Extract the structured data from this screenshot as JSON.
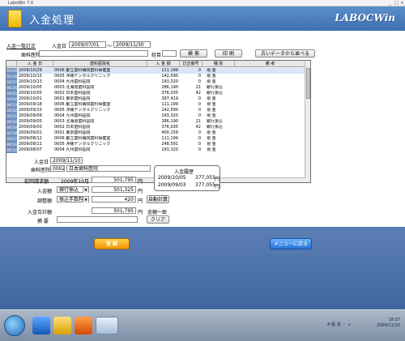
{
  "window": {
    "title": "LaboWin 7.0"
  },
  "header": {
    "title": "入金処理",
    "logo": "LABOCWin"
  },
  "tab": {
    "label": "入金一覧訂正"
  },
  "period": {
    "label": "入金日",
    "from": "2009/07/01",
    "sep": "～",
    "to": "2009/11/30"
  },
  "search": {
    "client_label": "歯科医院",
    "client_value": "",
    "lastname_label": "姓目",
    "lastname_value": "",
    "search_btn": "検 索",
    "print_btn": "印 刷",
    "reorder_btn": "古いデータから並べる"
  },
  "grid": {
    "headers": [
      "入 金 日",
      "歯科医院名",
      "入 金 額",
      "訂正番号",
      "種 別",
      "備 考"
    ],
    "rows": [
      {
        "idx": "00529",
        "date": "2009/10/29",
        "clinic": "0006 都立歯科病院歯科保健室",
        "amount": "111,199",
        "seq": "0",
        "type": "現 金"
      },
      {
        "idx": "00528",
        "date": "2009/10/15",
        "clinic": "0005 沖縄デンタルクリニック",
        "amount": "142,590",
        "seq": "0",
        "type": "現 金"
      },
      {
        "idx": "00527",
        "date": "2009/10/13",
        "clinic": "0004 九州歯科医院",
        "amount": "193,320",
        "seq": "0",
        "type": "現 金"
      },
      {
        "idx": "00526",
        "date": "2009/10/05",
        "clinic": "0003 北海道歯科医院",
        "amount": "286,190",
        "seq": "21",
        "type": "銀行振込"
      },
      {
        "idx": "00525",
        "date": "2009/10/05",
        "clinic": "0002 日本歯科医院",
        "amount": "376,035",
        "seq": "42",
        "type": "銀行振込"
      },
      {
        "idx": "00524",
        "date": "2009/10/01",
        "clinic": "0001 東京歯科医院",
        "amount": "397,419",
        "seq": "0",
        "type": "現 金"
      },
      {
        "idx": "00523",
        "date": "2009/09/18",
        "clinic": "0006 都立歯科病院歯科保健室",
        "amount": "111,199",
        "seq": "0",
        "type": "現 金"
      },
      {
        "idx": "00522",
        "date": "2009/09/15",
        "clinic": "0005 沖縄デンタルクリニック",
        "amount": "142,590",
        "seq": "0",
        "type": "現 金"
      },
      {
        "idx": "00521",
        "date": "2009/09/09",
        "clinic": "0004 九州歯科医院",
        "amount": "193,320",
        "seq": "0",
        "type": "現 金"
      },
      {
        "idx": "00520",
        "date": "2009/09/05",
        "clinic": "0003 北海道歯科医院",
        "amount": "286,190",
        "seq": "21",
        "type": "銀行振込"
      },
      {
        "idx": "00519",
        "date": "2009/09/03",
        "clinic": "0002 日本歯科医院",
        "amount": "376,035",
        "seq": "42",
        "type": "銀行振込"
      },
      {
        "idx": "00518",
        "date": "2009/09/01",
        "clinic": "0001 東京歯科医院",
        "amount": "400,159",
        "seq": "0",
        "type": "現 金"
      },
      {
        "idx": "00517",
        "date": "2009/08/12",
        "clinic": "0006 都立歯科病院歯科保健室",
        "amount": "111,199",
        "seq": "0",
        "type": "現 金"
      },
      {
        "idx": "00516",
        "date": "2009/08/11",
        "clinic": "0005 沖縄デンタルクリニック",
        "amount": "248,591",
        "seq": "0",
        "type": "現 金"
      },
      {
        "idx": "00515",
        "date": "2009/08/07",
        "clinic": "0004 九州歯科医院",
        "amount": "193,320",
        "seq": "0",
        "type": "現 金"
      }
    ]
  },
  "detail": {
    "date_label": "入金日",
    "date_value": "2009/11/10",
    "clinic_label": "歯科医院",
    "clinic_code": "0002",
    "clinic_name": "日本歯科医院",
    "prev_label": "前回請求額",
    "prev_month": "2009年10月",
    "prev_amount": "501,795",
    "yen": "円",
    "amount_label": "入金額",
    "amount_type": "銀行振込",
    "amount_value": "501,325",
    "adjust_label": "調整額",
    "adjust_type": "振込手数料",
    "adjust_value": "420",
    "auto_btn": "自動計算",
    "total_label": "入金合計額",
    "total_value": "501,795",
    "total_status": "金額一致",
    "note_label": "摘 要",
    "note_value": "",
    "clear_btn": "クリア"
  },
  "history": {
    "title": "入金履歴",
    "rows": [
      {
        "date": "2009/10/05",
        "amount": "377,055",
        "yen": "円"
      },
      {
        "date": "2009/09/03",
        "amount": "377,055",
        "yen": "円"
      }
    ]
  },
  "actions": {
    "register": "登 録",
    "menu": "メニューに戻る"
  },
  "taskbar": {
    "lang": "A 般 漢 ・ ⊿",
    "time": "18:27",
    "date": "2009/11/10"
  }
}
